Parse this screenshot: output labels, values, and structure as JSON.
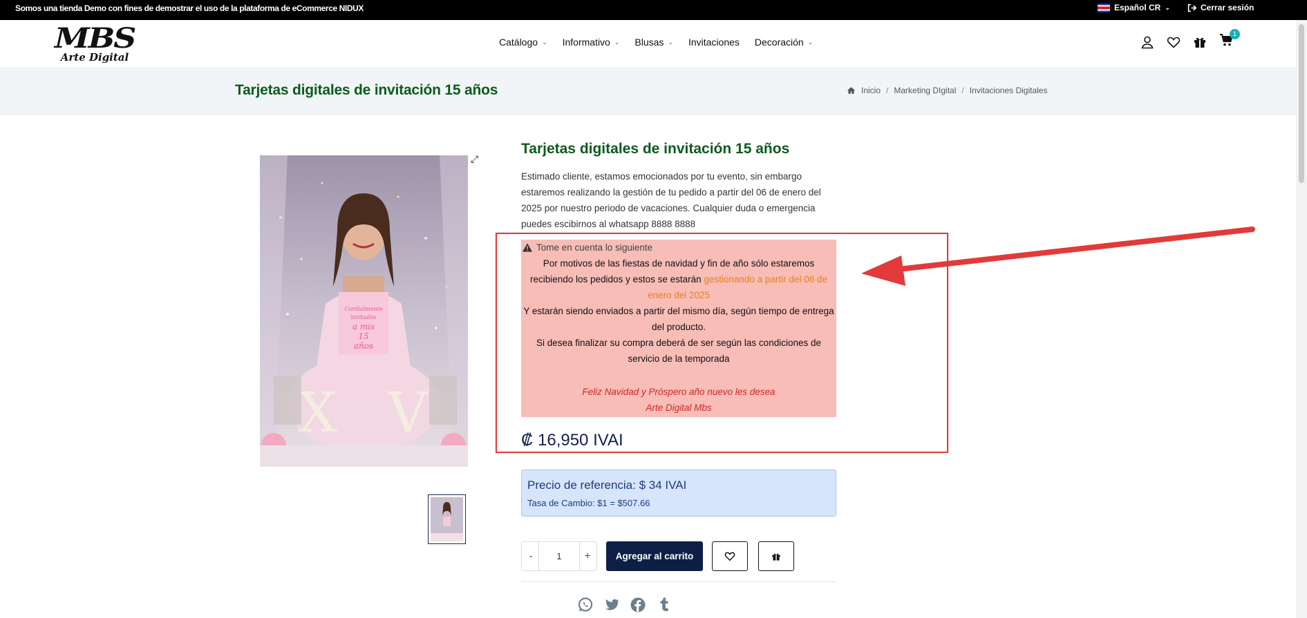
{
  "topbar": {
    "notice": "Somos una tienda Demo con fines de demostrar el uso de la plataforma de eCommerce NIDUX",
    "language": "Español CR",
    "logout": "Cerrar sesión"
  },
  "logo": {
    "line1": "MBS",
    "line2": "Arte Digital"
  },
  "nav": [
    "Catálogo",
    "Informativo",
    "Blusas",
    "Invitaciones",
    "Decoración"
  ],
  "nav_has_dropdown": [
    true,
    true,
    true,
    false,
    true
  ],
  "cart": {
    "count": "1"
  },
  "page": {
    "title": "Tarjetas digitales de invitación 15 años",
    "breadcrumb": [
      "Inicio",
      "Marketing DIgital",
      "Invitaciones Digitales"
    ]
  },
  "product": {
    "title": "Tarjetas digitales de invitación 15 años",
    "description": "Estimado cliente, estamos emocionados por tu evento, sin embargo estaremos realizando la gestión de tu pedido a partir del 06 de enero del 2025 por nuestro periodo de vacaciones. Cualquier duda o emergencia puedes escibirnos al whatsapp 8888 8888",
    "image_text": [
      "Cordialmente",
      "invitados",
      "a mis",
      "15",
      "años"
    ],
    "notice": {
      "heading": "Tome en cuenta lo siguiente",
      "line1_a": "Por motivos de las fiestas de navidad y fin de año sólo estaremos recibiendo los pedidos y estos se estarán ",
      "line1_highlight": "gestionando a partir del 06 de enero del 2025",
      "line2": "Y estarán siendo enviados a partir del mismo día, según tiempo de entrega del producto.",
      "line3": "Si desea finalizar su compra deberá de ser según las condiciones de servicio de la temporada",
      "closing1": "Feliz Navidad y Próspero año nuevo les desea",
      "closing2": "Arte Digital Mbs"
    },
    "price": "₡ 16,950 IVAI",
    "reference_price": "Precio de referencia: $ 34 IVAI",
    "exchange_rate": "Tasa de Cambio: $1 = $507.66",
    "quantity": "1",
    "add_to_cart": "Agregar al carrito"
  },
  "colors": {
    "title_green": "#0c5a1d",
    "notice_bg": "#f7bdb6",
    "highlight_orange": "#e8821e",
    "button_navy": "#0d1f45",
    "annotation_red": "#e23a3a"
  }
}
